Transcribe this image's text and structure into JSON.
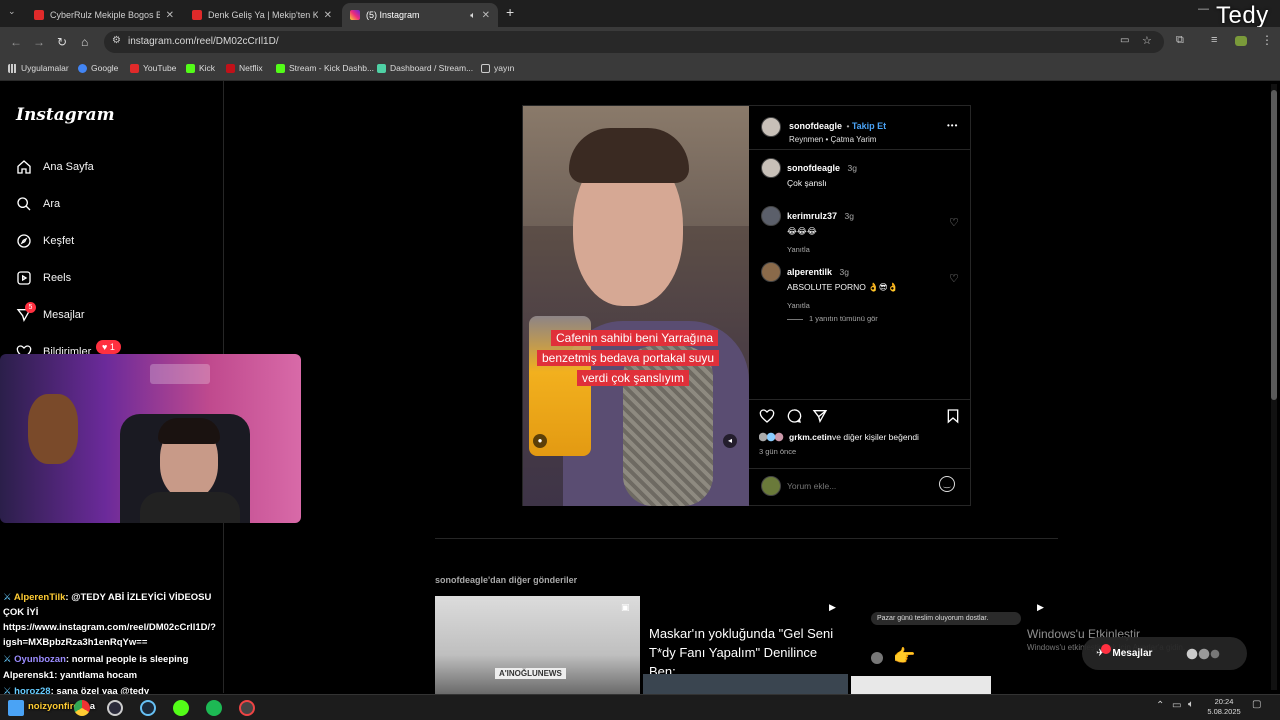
{
  "browser": {
    "tabs": [
      {
        "title": "CyberRulz Mekiple Bogos Bintı",
        "color": "#e02a2a"
      },
      {
        "title": "Denk Geliş Ya | Mekip'ten Kesit",
        "color": "#e02a2a"
      },
      {
        "title": "(5) Instagram",
        "color": "#d6249f"
      }
    ],
    "new_tab": "+",
    "url": "instagram.com/reel/DM02cCrIl1D/",
    "bookmarks": [
      "Uygulamalar",
      "Google",
      "YouTube",
      "Kick",
      "Netflix",
      "Stream - Kick Dashb...",
      "Dashboard / Stream...",
      "yayın"
    ]
  },
  "streamer_name": "Tedy",
  "sidebar": {
    "logo": "Instagram",
    "items": [
      {
        "label": "Ana Sayfa",
        "icon": "home-icon"
      },
      {
        "label": "Ara",
        "icon": "search-icon"
      },
      {
        "label": "Keşfet",
        "icon": "compass-icon"
      },
      {
        "label": "Reels",
        "icon": "reels-icon"
      },
      {
        "label": "Mesajlar",
        "icon": "messenger-icon",
        "badge": "5"
      },
      {
        "label": "Bildirimler",
        "icon": "heart-icon"
      }
    ],
    "notif_badge": "1"
  },
  "post": {
    "author": "sonofdeagle",
    "follow": "Takip Et",
    "audio": "Reynmen • Çatma Yarim",
    "more": "•••",
    "caption_lines": [
      "Cafenin sahibi beni  Yarrağına",
      "benzetmiş bedava portakal suyu",
      "verdi çok şanslıyım"
    ],
    "comments": [
      {
        "user": "sonofdeagle",
        "time": "3g",
        "text": "Çok şanslı",
        "reply": ""
      },
      {
        "user": "kerimrulz37",
        "time": "3g",
        "text": "😂😂😂",
        "reply": "Yanıtla"
      },
      {
        "user": "alperentilk",
        "time": "3g",
        "text": "ABSOLUTE PORNO 👌😎👌",
        "reply": "Yanıtla"
      }
    ],
    "view_replies": "1 yanıtın tümünü gör",
    "likes_user": "grkm.cetin",
    "likes_rest": " ve diğer kişiler beğendi",
    "ago": "3 gün önce",
    "comment_placeholder": "Yorum ekle..."
  },
  "more_posts": {
    "heading": "sonofdeagle'dan diğer gönderiler",
    "tile2_text": "Maskar'ın yokluğunda \"Gel Seni T*dy Fanı Yapalım\" Denilince Ben;",
    "tile3_bubble": "Pazar günü teslim oluyorum dostlar.",
    "tile1_sign": "A'INOĞLUNEWS"
  },
  "messages_button": "Mesajlar",
  "windows_activate": {
    "title": "Windows'u Etkinleştir",
    "sub": "Windows'u etkinleştirmek için Ayarlar'a gidin."
  },
  "chat": [
    {
      "user": "AlperenTilk",
      "text": ": @TEDY ABİ İZLEYİCİ VİDEOSU"
    },
    {
      "user": "",
      "text": "ÇOK İYİ"
    },
    {
      "user": "",
      "text": "https://www.instagram.com/reel/DM02cCrIl1D/?"
    },
    {
      "user": "",
      "text": "igsh=MXBpbzRza3h1enRqYw=="
    },
    {
      "user": "Oyunbozan",
      "text": ": normal people is sleeping"
    },
    {
      "user": "Alperensk1",
      "text": ": yanıtlama hocam"
    },
    {
      "user": "horoz28",
      "text": ": sana özel yaa @tedy"
    },
    {
      "user": "noizyonfire",
      "text": ": sa"
    }
  ],
  "taskbar": {
    "time": "20:24",
    "date": "5.08.2025"
  }
}
